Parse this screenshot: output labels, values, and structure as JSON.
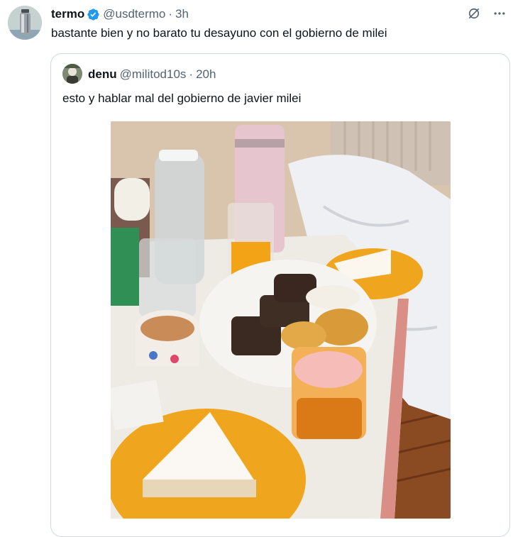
{
  "tweet": {
    "display_name": "termo",
    "handle": "@usdtermo",
    "separator": "·",
    "time": "3h",
    "text": "bastante bien y no barato tu desayuno con el gobierno de milei",
    "verified_color": "#1d9bf0"
  },
  "quote": {
    "display_name": "denu",
    "handle": "@militod10s",
    "separator": "·",
    "time": "20h",
    "text": "esto y hablar mal del gobierno de javier milei"
  },
  "icons": {
    "grok": "grok-icon",
    "more": "more-icon",
    "verified": "verified-badge-icon"
  },
  "colors": {
    "text_primary": "#0f1419",
    "text_secondary": "#536471",
    "border": "#cfd9de",
    "accent": "#1d9bf0"
  }
}
